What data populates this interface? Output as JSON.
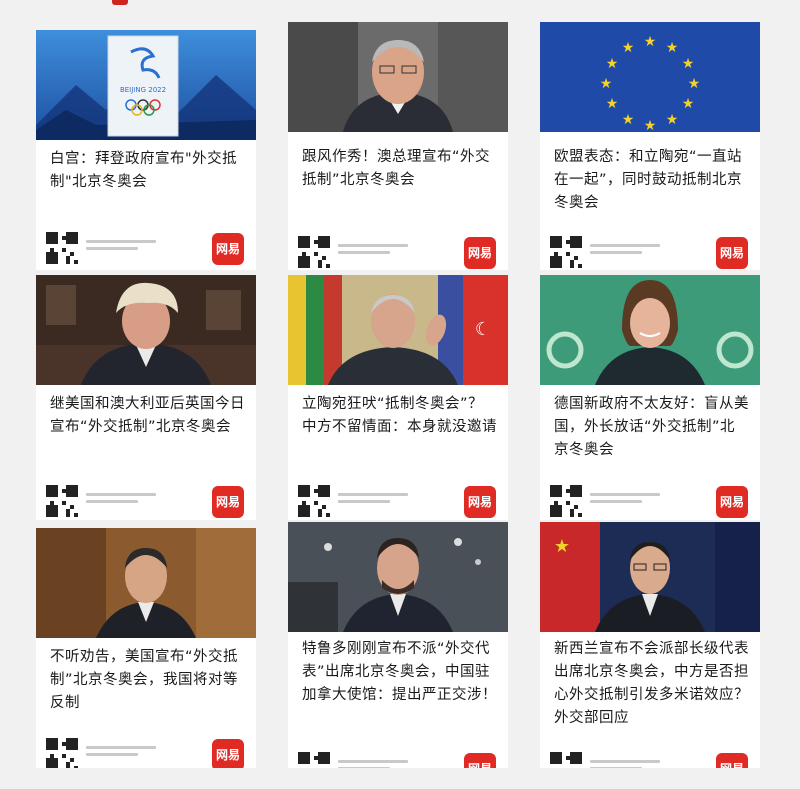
{
  "cards": [
    {
      "headline": "白宫：拜登政府宣布\"外交抵制\"北京冬奥会",
      "image": "beijing-2022-banner-photo",
      "app_badge": "网易"
    },
    {
      "headline": "跟风作秀！澳总理宣布“外交抵制”北京冬奥会",
      "image": "australian-pm-photo",
      "app_badge": "网易"
    },
    {
      "headline": "欧盟表态：和立陶宛“一直站在一起”，同时鼓动抵制北京冬奥会",
      "image": "eu-flag-photo",
      "app_badge": "网易"
    },
    {
      "headline": "继美国和澳大利亚后英国今日宣布“外交抵制”北京冬奥会",
      "image": "uk-pm-photo",
      "app_badge": "网易"
    },
    {
      "headline": "立陶宛狂吠“抵制冬奥会”？中方不留情面：本身就没邀请",
      "image": "lithuanian-president-photo",
      "app_badge": "网易"
    },
    {
      "headline": "德国新政府不太友好：盲从美国，外长放话“外交抵制”北京冬奥会",
      "image": "german-foreign-minister-photo",
      "app_badge": "网易"
    },
    {
      "headline": "不听劝告，美国宣布“外交抵制”北京冬奥会，我国将对等反制",
      "image": "japanese-pm-photo",
      "app_badge": "网易"
    },
    {
      "headline": "特鲁多刚刚宣布不派“外交代表”出席北京冬奥会，中国驻加拿大使馆：提出严正交涉！",
      "image": "canadian-pm-photo",
      "app_badge": "网易"
    },
    {
      "headline": "新西兰宣布不会派部长级代表出席北京冬奥会，中方是否担心外交抵制引发多米诺效应？外交部回应",
      "image": "chinese-spokesperson-photo",
      "app_badge": "网易"
    }
  ],
  "colors": {
    "accent": "#e02a24",
    "background": "#f1f1f1"
  }
}
